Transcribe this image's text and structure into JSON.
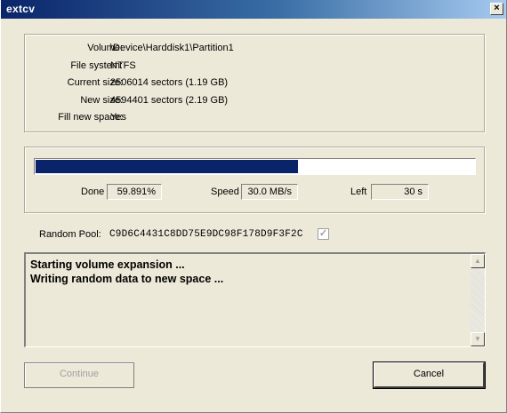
{
  "window": {
    "title": "extcv",
    "close_glyph": "×"
  },
  "info": {
    "rows": [
      {
        "label": "Volume:",
        "value": "\\Device\\Harddisk1\\Partition1"
      },
      {
        "label": "File system:",
        "value": "NTFS"
      },
      {
        "label": "Current size:",
        "value": "2506014 sectors (1.19 GB)"
      },
      {
        "label": "New size:",
        "value": "4594401 sectors (2.19 GB)"
      },
      {
        "label": "Fill new space:",
        "value": "Yes"
      }
    ]
  },
  "progress": {
    "fraction": 0.59891,
    "fill_color": "#0a246a",
    "done_label": "Done",
    "done_value": "59.891%",
    "speed_label": "Speed",
    "speed_value": "30.0 MB/s",
    "left_label": "Left",
    "left_value": "30 s"
  },
  "random_pool": {
    "label": "Random Pool:",
    "value": "C9D6C4431C8DD75E9DC98F178D9F3F2C",
    "checked": true,
    "check_glyph": "✓"
  },
  "log": {
    "lines": [
      "Starting volume expansion ...",
      "Writing random data to new space ..."
    ],
    "scroll_up_glyph": "▲",
    "scroll_down_glyph": "▼"
  },
  "buttons": {
    "continue_label": "Continue",
    "continue_enabled": false,
    "cancel_label": "Cancel"
  }
}
